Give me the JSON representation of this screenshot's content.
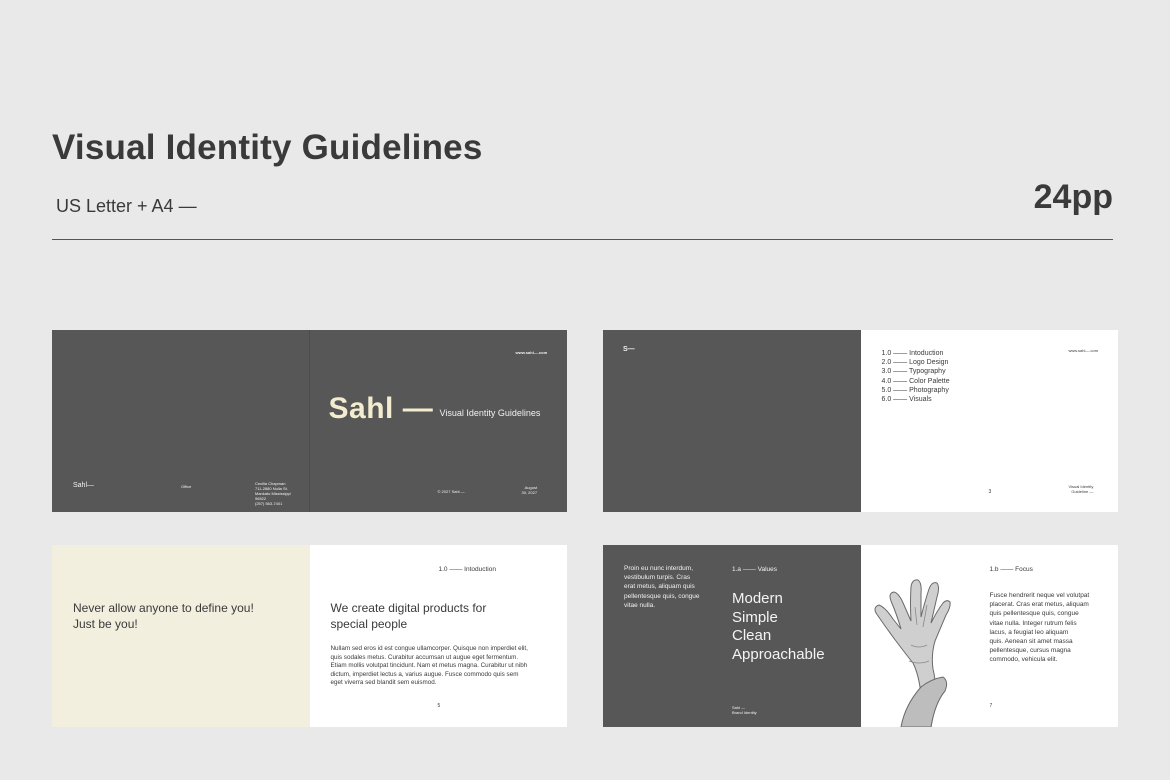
{
  "header": {
    "title": "Visual Identity Guidelines",
    "format": "US Letter + A4  —",
    "pages": "24pp"
  },
  "spread1": {
    "left": {
      "logo": "Sahl—",
      "office_label": "Office",
      "address_lines": [
        "Cecilia Chapman",
        "711-2880 Nulla St.",
        "Mankato Mississippi",
        "96522",
        "(257) 563-7401"
      ]
    },
    "right": {
      "url": "www.sahl—.com",
      "brand": "Sahl —",
      "subtitle": "Visual Identity Guidelines",
      "copyright": "© 2027 Sahl —",
      "date_lines": [
        "August",
        "30, 2027"
      ]
    }
  },
  "spread2": {
    "left": {
      "logo": "S—"
    },
    "right": {
      "url": "www.sahl—.com",
      "toc": [
        {
          "num": "1.0",
          "label": "Intoduction"
        },
        {
          "num": "2.0",
          "label": "Logo Design"
        },
        {
          "num": "3.0",
          "label": "Typography"
        },
        {
          "num": "4.0",
          "label": "Color Palette"
        },
        {
          "num": "5.0",
          "label": "Photography"
        },
        {
          "num": "6.0",
          "label": "Visuals"
        }
      ],
      "page_number": "3",
      "footer_lines": [
        "Visual Identity",
        "Guideline —"
      ]
    }
  },
  "spread3": {
    "left": {
      "quote_lines": [
        "Never allow anyone to define you!",
        "Just be you!"
      ]
    },
    "right": {
      "section": "1.0 —— Intoduction",
      "heading_lines": [
        "We create digital products for",
        "special people"
      ],
      "body_lines": [
        "Nullam sed eros id est congue ullamcorper. Quisque non imperdiet elit,",
        "quis sodales metus. Curabitur accumsan ut augue eget fermentum.",
        "Etiam mollis volutpat tincidunt. Nam et metus magna. Curabitur ut nibh",
        "dictum, imperdiet lectus a, varius augue. Fusce commodo quis sem",
        "eget viverra sed blandit sem euismod."
      ],
      "page_number": "5"
    }
  },
  "spread4": {
    "left": {
      "intro_lines": [
        "Proin eu nunc interdum,",
        "vestibulum turpis. Cras",
        "erat metus, aliquam quis",
        "pellentesque quis, congue",
        "vitae nulla."
      ],
      "section": "1.a —— Values",
      "values": [
        "Modern",
        "Simple",
        "Clean",
        "Approachable"
      ],
      "footer_lines": [
        "Sahl —",
        "Brand Identity"
      ]
    },
    "right": {
      "section": "1.b —— Focus",
      "body_lines": [
        "Fusce hendrerit neque vel volutpat",
        "placerat. Cras erat metus, aliquam",
        "quis pellentesque quis, congue",
        "vitae nulla. Integer rutrum felis",
        "lacus, a feugiat leo aliquam",
        "quis. Aenean sit amet massa",
        "pellentesque, cursus magna",
        "commodo, vehicula elit."
      ],
      "page_number": "7"
    }
  }
}
